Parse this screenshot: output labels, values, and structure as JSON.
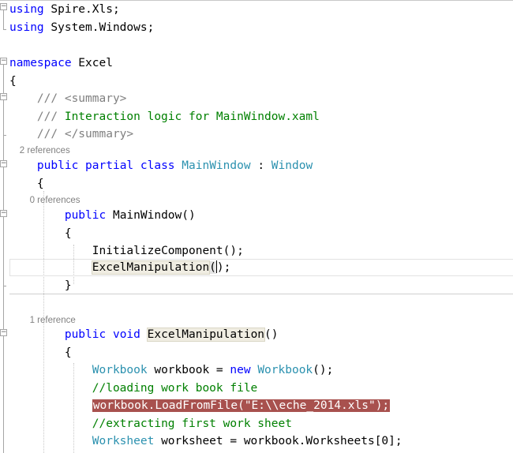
{
  "editor": {
    "codelens": {
      "two_refs": "2 references",
      "zero_refs": "0 references",
      "one_ref": "1 reference"
    },
    "tokens": {
      "using": "using",
      "spire_ns": " Spire.Xls;",
      "system_ns": " System.Windows;",
      "namespace": "namespace",
      "namespace_name": " Excel",
      "open_brace": "{",
      "close_brace": "}",
      "doc_prefix": "/// ",
      "summary_open": "<summary>",
      "summary_text": "Interaction logic for MainWindow.xaml",
      "summary_close": "</summary>",
      "public": "public",
      "partial": "partial",
      "class": "class",
      "void": "void",
      "new": "new",
      "class_name": "MainWindow",
      "colon": " : ",
      "base_class": "Window",
      "ctor_name": " MainWindow()",
      "init_call": "InitializeComponent();",
      "method_name": "ExcelManipulation",
      "call_paren_open": "(",
      "call_paren_close": ");",
      "decl_parens": "()",
      "workbook_type": "Workbook",
      "workbook_decl": " workbook = ",
      "workbook_ctor": "();",
      "comment_loading": "//loading work book file",
      "load_call": "workbook.LoadFromFile(",
      "load_path": "\"E:\\\\eche_2014.xls\"",
      "load_end": ");",
      "comment_extract": "//extracting first work sheet",
      "worksheet_type": "Worksheet",
      "worksheet_decl": " worksheet = workbook.Worksheets[0];"
    }
  }
}
